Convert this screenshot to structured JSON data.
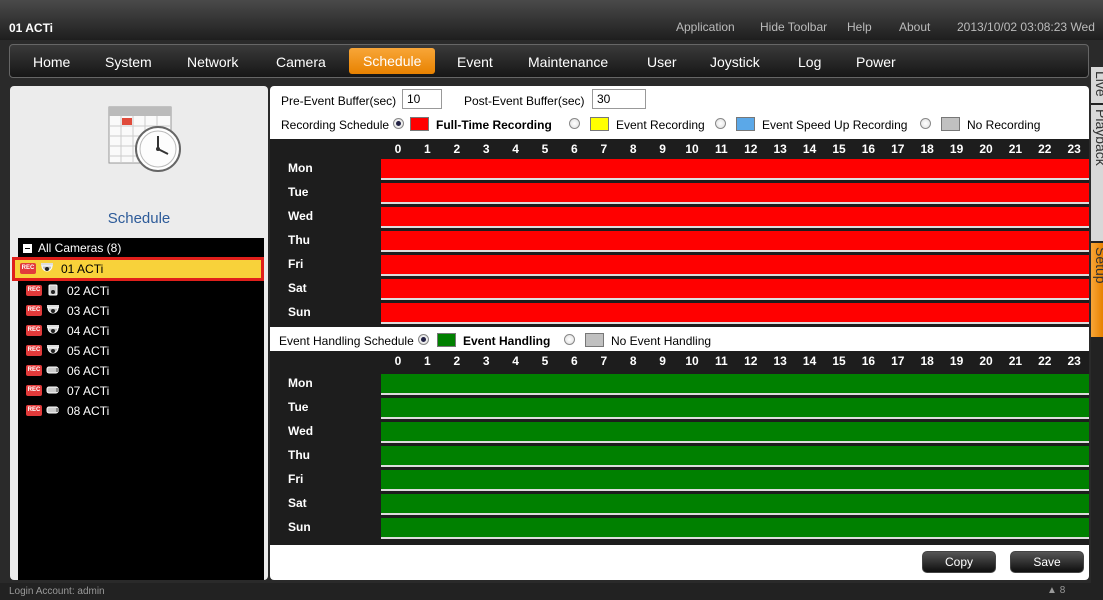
{
  "window": {
    "title": "01 ACTi"
  },
  "topmenu": {
    "items": [
      "Application",
      "Hide Toolbar",
      "Help",
      "About"
    ],
    "datetime": "2013/10/02 03:08:23 Wed"
  },
  "nav": {
    "items": [
      "Home",
      "System",
      "Network",
      "Camera",
      "Schedule",
      "Event",
      "Maintenance",
      "User",
      "Joystick",
      "Log",
      "Power"
    ],
    "active": "Schedule"
  },
  "sidetabs": [
    "Live",
    "Playback",
    "Setup"
  ],
  "left": {
    "title": "Schedule",
    "tree_root": "All Cameras (8)",
    "cameras": [
      {
        "label": "01 ACTi",
        "icon": "dome-camera-icon",
        "selected": true
      },
      {
        "label": "02 ACTi",
        "icon": "box-camera-icon"
      },
      {
        "label": "03 ACTi",
        "icon": "dome-camera-icon"
      },
      {
        "label": "04 ACTi",
        "icon": "dome-camera-icon"
      },
      {
        "label": "05 ACTi",
        "icon": "dome-camera-icon"
      },
      {
        "label": "06 ACTi",
        "icon": "bullet-camera-icon"
      },
      {
        "label": "07 ACTi",
        "icon": "bullet-camera-icon"
      },
      {
        "label": "08 ACTi",
        "icon": "bullet-camera-icon"
      }
    ],
    "rec_badge": "REC"
  },
  "buffers": {
    "pre_label": "Pre-Event Buffer(sec)",
    "pre_value": "10",
    "post_label": "Post-Event Buffer(sec)",
    "post_value": "30"
  },
  "recording": {
    "label": "Recording Schedule",
    "options": [
      {
        "label": "Full-Time Recording",
        "color": "#ff0000",
        "selected": true
      },
      {
        "label": "Event Recording",
        "color": "#ffff00"
      },
      {
        "label": "Event Speed Up Recording",
        "color": "#5ba8e8"
      },
      {
        "label": "No Recording",
        "color": "#c0c0c0"
      }
    ],
    "fill_color": "#ff0000"
  },
  "event": {
    "label": "Event Handling Schedule",
    "options": [
      {
        "label": "Event Handling",
        "color": "#008000",
        "selected": true
      },
      {
        "label": "No Event Handling",
        "color": "#c0c0c0"
      }
    ],
    "fill_color": "#008000"
  },
  "hours": [
    "0",
    "1",
    "2",
    "3",
    "4",
    "5",
    "6",
    "7",
    "8",
    "9",
    "10",
    "11",
    "12",
    "13",
    "14",
    "15",
    "16",
    "17",
    "18",
    "19",
    "20",
    "21",
    "22",
    "23"
  ],
  "days": [
    "Mon",
    "Tue",
    "Wed",
    "Thu",
    "Fri",
    "Sat",
    "Sun"
  ],
  "buttons": {
    "copy": "Copy",
    "save": "Save"
  },
  "status": {
    "login": "Login Account: admin",
    "network_count": "8"
  }
}
